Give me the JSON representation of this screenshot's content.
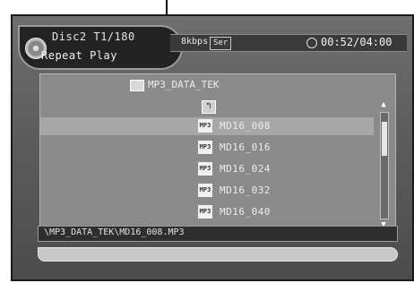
{
  "header": {
    "track_info": "Disc2 T1/180",
    "play_mode": "Repeat Play",
    "bitrate": "8kbps",
    "codec": "Ser",
    "time": "00:52/04:00"
  },
  "browser": {
    "folder_name": "MP3_DATA_TEK",
    "parent_symbol": "↰",
    "mp3_icon_label": "MP3",
    "files": [
      {
        "name": "MD16_008"
      },
      {
        "name": "MD16_016"
      },
      {
        "name": "MD16_024"
      },
      {
        "name": "MD16_032"
      },
      {
        "name": "MD16_040"
      }
    ],
    "scroll_position": 0.1
  },
  "status": {
    "path": "\\MP3_DATA_TEK\\MD16_008.MP3"
  },
  "icons": [
    "disc-icon",
    "clock-icon",
    "folder-icon",
    "parent-folder-icon",
    "mp3-file-icon",
    "scroll-up-icon",
    "scroll-down-icon"
  ]
}
